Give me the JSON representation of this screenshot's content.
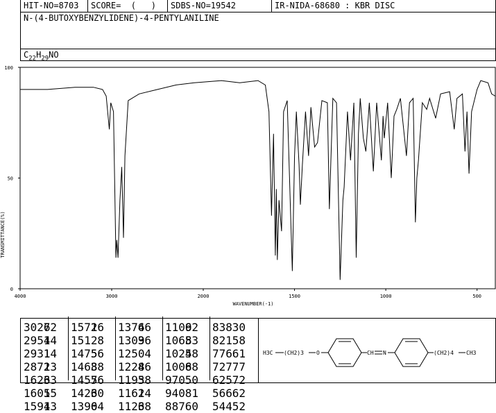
{
  "header": {
    "hit_no": "HIT-NO=8703",
    "score": "SCORE=  (   )",
    "sdbs_no": "SDBS-NO=19542",
    "method": "IR-NIDA-68680 : KBR DISC"
  },
  "compound": {
    "name": "N-(4-BUTOXYBENZYLIDENE)-4-PENTYLANILINE",
    "formula_c": "C",
    "formula_c_sub": "22",
    "formula_h": "H",
    "formula_h_sub": "29",
    "formula_rest": "NO"
  },
  "structure": {
    "left_group": "H₃C—(CH₂)₃—O",
    "linker": "CH=N",
    "right_group": "(CH₂)₄—CH₃",
    "left_text": "H3C",
    "left_chain": "(CH2)3",
    "oxygen": "O",
    "ch": "CH",
    "n": "N",
    "right_chain": "(CH2)4",
    "right_end": "CH3"
  },
  "chart_data": {
    "type": "line",
    "title": "",
    "xlabel": "WAVENUMBER(-1)",
    "ylabel": "TRANSMITTANCE(%)",
    "xlim": [
      4000,
      400
    ],
    "ylim": [
      0,
      100
    ],
    "x_ticks": [
      "4000",
      "3000",
      "2000",
      "1500",
      "1000",
      "500"
    ],
    "y_ticks": [
      "100",
      "50",
      "0"
    ],
    "series": [
      {
        "values": [
          [
            4000,
            90
          ],
          [
            3700,
            90
          ],
          [
            3400,
            91
          ],
          [
            3200,
            91
          ],
          [
            3100,
            90
          ],
          [
            3060,
            87
          ],
          [
            3026,
            72
          ],
          [
            3010,
            84
          ],
          [
            2980,
            80
          ],
          [
            2954,
            14
          ],
          [
            2945,
            22
          ],
          [
            2931,
            14
          ],
          [
            2910,
            40
          ],
          [
            2890,
            55
          ],
          [
            2871,
            23
          ],
          [
            2855,
            60
          ],
          [
            2820,
            85
          ],
          [
            2700,
            88
          ],
          [
            2500,
            90
          ],
          [
            2300,
            92
          ],
          [
            2100,
            93
          ],
          [
            1900,
            94
          ],
          [
            1800,
            93
          ],
          [
            1700,
            94
          ],
          [
            1660,
            92
          ],
          [
            1640,
            80
          ],
          [
            1626,
            33
          ],
          [
            1615,
            70
          ],
          [
            1605,
            15
          ],
          [
            1600,
            45
          ],
          [
            1594,
            13
          ],
          [
            1585,
            40
          ],
          [
            1571,
            26
          ],
          [
            1560,
            80
          ],
          [
            1540,
            85
          ],
          [
            1512,
            8
          ],
          [
            1500,
            60
          ],
          [
            1490,
            80
          ],
          [
            1475,
            56
          ],
          [
            1468,
            38
          ],
          [
            1457,
            56
          ],
          [
            1440,
            80
          ],
          [
            1423,
            60
          ],
          [
            1410,
            82
          ],
          [
            1390,
            64
          ],
          [
            1374,
            66
          ],
          [
            1350,
            85
          ],
          [
            1320,
            84
          ],
          [
            1309,
            36
          ],
          [
            1290,
            86
          ],
          [
            1270,
            84
          ],
          [
            1250,
            4
          ],
          [
            1235,
            40
          ],
          [
            1228,
            46
          ],
          [
            1210,
            80
          ],
          [
            1193,
            58
          ],
          [
            1175,
            84
          ],
          [
            1162,
            14
          ],
          [
            1150,
            70
          ],
          [
            1140,
            86
          ],
          [
            1123,
            68
          ],
          [
            1109,
            62
          ],
          [
            1090,
            84
          ],
          [
            1068,
            53
          ],
          [
            1050,
            84
          ],
          [
            1024,
            58
          ],
          [
            1015,
            78
          ],
          [
            1008,
            68
          ],
          [
            990,
            84
          ],
          [
            970,
            50
          ],
          [
            955,
            78
          ],
          [
            940,
            81
          ],
          [
            920,
            86
          ],
          [
            887,
            60
          ],
          [
            870,
            84
          ],
          [
            850,
            86
          ],
          [
            838,
            30
          ],
          [
            830,
            50
          ],
          [
            821,
            58
          ],
          [
            800,
            84
          ],
          [
            776,
            81
          ],
          [
            760,
            86
          ],
          [
            727,
            77
          ],
          [
            700,
            88
          ],
          [
            650,
            89
          ],
          [
            625,
            72
          ],
          [
            610,
            86
          ],
          [
            580,
            88
          ],
          [
            566,
            62
          ],
          [
            555,
            80
          ],
          [
            544,
            52
          ],
          [
            530,
            80
          ],
          [
            500,
            90
          ],
          [
            480,
            94
          ],
          [
            440,
            93
          ],
          [
            420,
            88
          ],
          [
            400,
            87
          ]
        ]
      }
    ],
    "grid": false,
    "peak_table": [
      {
        "wn": "3026",
        "t": "72"
      },
      {
        "wn": "2954",
        "t": "14"
      },
      {
        "wn": "2931",
        "t": "14"
      },
      {
        "wn": "2871",
        "t": "23"
      },
      {
        "wn": "1626",
        "t": "33"
      },
      {
        "wn": "1605",
        "t": "15"
      },
      {
        "wn": "1594",
        "t": "13"
      },
      {
        "wn": "1571",
        "t": "26"
      },
      {
        "wn": "1512",
        "t": "8"
      },
      {
        "wn": "1475",
        "t": "56"
      },
      {
        "wn": "1468",
        "t": "38"
      },
      {
        "wn": "1457",
        "t": "56"
      },
      {
        "wn": "1423",
        "t": "60"
      },
      {
        "wn": "1390",
        "t": "64"
      },
      {
        "wn": "1374",
        "t": "66"
      },
      {
        "wn": "1309",
        "t": "36"
      },
      {
        "wn": "1250",
        "t": "4"
      },
      {
        "wn": "1228",
        "t": "46"
      },
      {
        "wn": "1193",
        "t": "58"
      },
      {
        "wn": "1162",
        "t": "14"
      },
      {
        "wn": "1123",
        "t": "68"
      },
      {
        "wn": "1109",
        "t": "62"
      },
      {
        "wn": "1068",
        "t": "53"
      },
      {
        "wn": "1024",
        "t": "58"
      },
      {
        "wn": "1008",
        "t": "68"
      },
      {
        "wn": "970",
        "t": "50"
      },
      {
        "wn": "940",
        "t": "81"
      },
      {
        "wn": "887",
        "t": "60"
      },
      {
        "wn": "838",
        "t": "30"
      },
      {
        "wn": "821",
        "t": "58"
      },
      {
        "wn": "776",
        "t": "61"
      },
      {
        "wn": "727",
        "t": "77"
      },
      {
        "wn": "625",
        "t": "72"
      },
      {
        "wn": "566",
        "t": "62"
      },
      {
        "wn": "544",
        "t": "52"
      }
    ]
  }
}
